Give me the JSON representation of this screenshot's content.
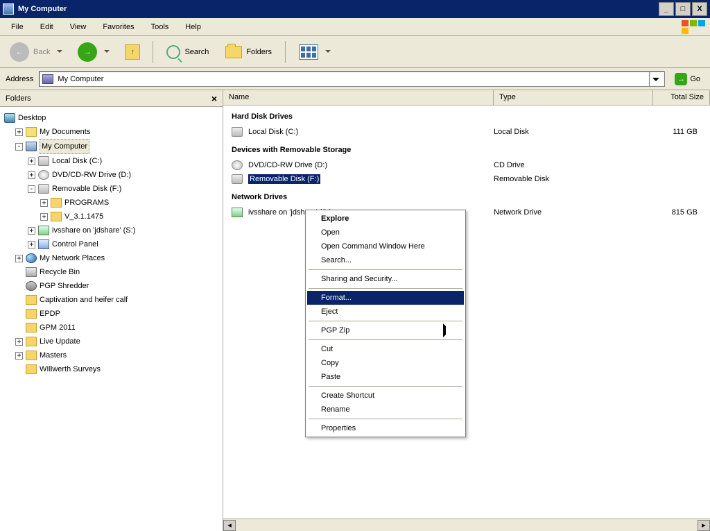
{
  "window": {
    "title": "My Computer",
    "buttons": {
      "min": "_",
      "max": "□",
      "close": "X"
    }
  },
  "menubar": [
    "File",
    "Edit",
    "View",
    "Favorites",
    "Tools",
    "Help"
  ],
  "toolbar": {
    "back": "Back",
    "search": "Search",
    "folders": "Folders"
  },
  "address": {
    "label": "Address",
    "value": "My Computer",
    "go": "Go"
  },
  "folders_pane": {
    "title": "Folders"
  },
  "tree": {
    "desktop": "Desktop",
    "mydocs": "My Documents",
    "mycomputer": "My Computer",
    "localc": "Local Disk (C:)",
    "dvd": "DVD/CD-RW Drive (D:)",
    "remf": "Removable Disk (F:)",
    "programs": "PROGRAMS",
    "v31": "V_3.1.1475",
    "ivs": "ivsshare on 'jdshare' (S:)",
    "cpanel": "Control Panel",
    "netplaces": "My Network Places",
    "recycle": "Recycle Bin",
    "pgp": "PGP Shredder",
    "capt": "Captivation and heifer calf",
    "epdp": "EPDP",
    "gpm": "GPM 2011",
    "live": "Live Update",
    "masters": "Masters",
    "willw": "WIllwerth Surveys"
  },
  "columns": {
    "name": "Name",
    "type": "Type",
    "size": "Total Size"
  },
  "groups": {
    "hdd": "Hard Disk Drives",
    "removable": "Devices with Removable Storage",
    "network": "Network Drives"
  },
  "items": {
    "localc": {
      "name": "Local Disk (C:)",
      "type": "Local Disk",
      "size": "111 GB"
    },
    "dvd": {
      "name": "DVD/CD-RW Drive (D:)",
      "type": "CD Drive",
      "size": ""
    },
    "remf": {
      "name": "Removable Disk (F:)",
      "type": "Removable Disk",
      "size": ""
    },
    "ivs": {
      "name": "ivsshare on 'jdshare' (S:)",
      "type": "Network Drive",
      "size": "815 GB"
    }
  },
  "context_menu": {
    "explore": "Explore",
    "open": "Open",
    "opencmd": "Open Command Window Here",
    "search": "Search...",
    "sharing": "Sharing and Security...",
    "format": "Format...",
    "eject": "Eject",
    "pgpzip": "PGP Zip",
    "cut": "Cut",
    "copy": "Copy",
    "paste": "Paste",
    "shortcut": "Create Shortcut",
    "rename": "Rename",
    "properties": "Properties"
  }
}
